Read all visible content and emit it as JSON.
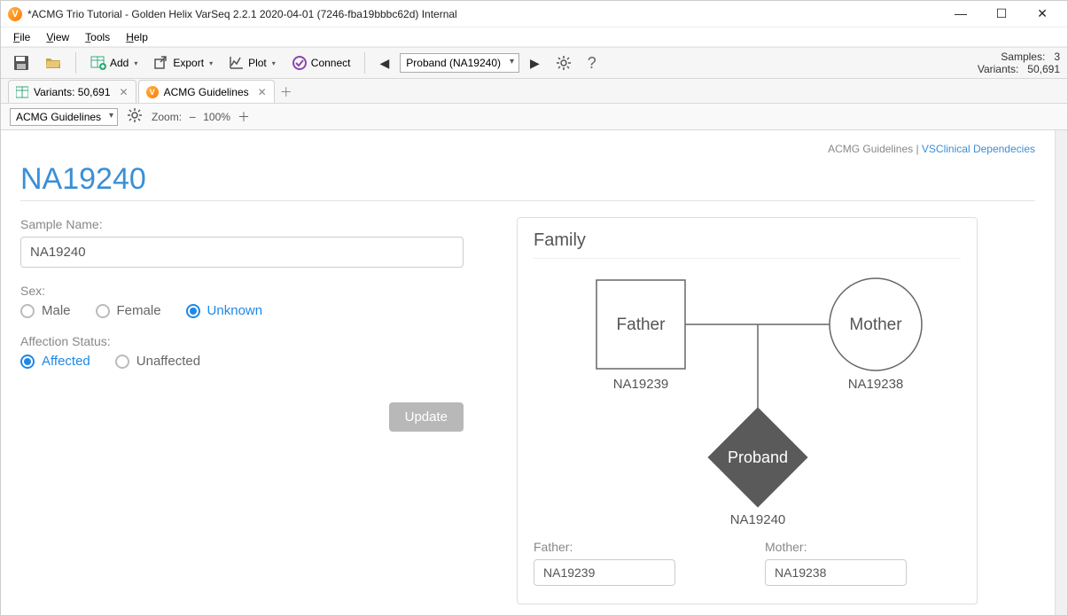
{
  "titlebar": {
    "title": "*ACMG Trio Tutorial - Golden Helix VarSeq 2.2.1 2020-04-01 (7246-fba19bbbc62d) Internal"
  },
  "menu": {
    "file": "File",
    "view": "View",
    "tools": "Tools",
    "help": "Help"
  },
  "toolbar": {
    "add": "Add",
    "export": "Export",
    "plot": "Plot",
    "connect": "Connect",
    "sample_selected": "Proband (NA19240)",
    "samples_label": "Samples:",
    "samples_value": "3",
    "variants_label": "Variants:",
    "variants_value": "50,691"
  },
  "tabs": {
    "variants": "Variants: 50,691",
    "acmg": "ACMG Guidelines"
  },
  "subtoolbar": {
    "selected": "ACMG Guidelines",
    "zoom_label": "Zoom:",
    "zoom_value": "100%"
  },
  "breadcrumb": {
    "acmg": "ACMG Guidelines",
    "sep": " | ",
    "vsclinical": "VSClinical Dependecies"
  },
  "page_title": "NA19240",
  "form": {
    "sample_name_label": "Sample Name:",
    "sample_name_value": "NA19240",
    "sex_label": "Sex:",
    "sex_male": "Male",
    "sex_female": "Female",
    "sex_unknown": "Unknown",
    "affection_label": "Affection Status:",
    "affected": "Affected",
    "unaffected": "Unaffected",
    "update": "Update"
  },
  "family": {
    "title": "Family",
    "father_pedigree": "Father",
    "mother_pedigree": "Mother",
    "proband_pedigree": "Proband",
    "father_id": "NA19239",
    "mother_id": "NA19238",
    "proband_id": "NA19240",
    "father_label": "Father:",
    "mother_label": "Mother:",
    "father_value": "NA19239",
    "mother_value": "NA19238"
  }
}
